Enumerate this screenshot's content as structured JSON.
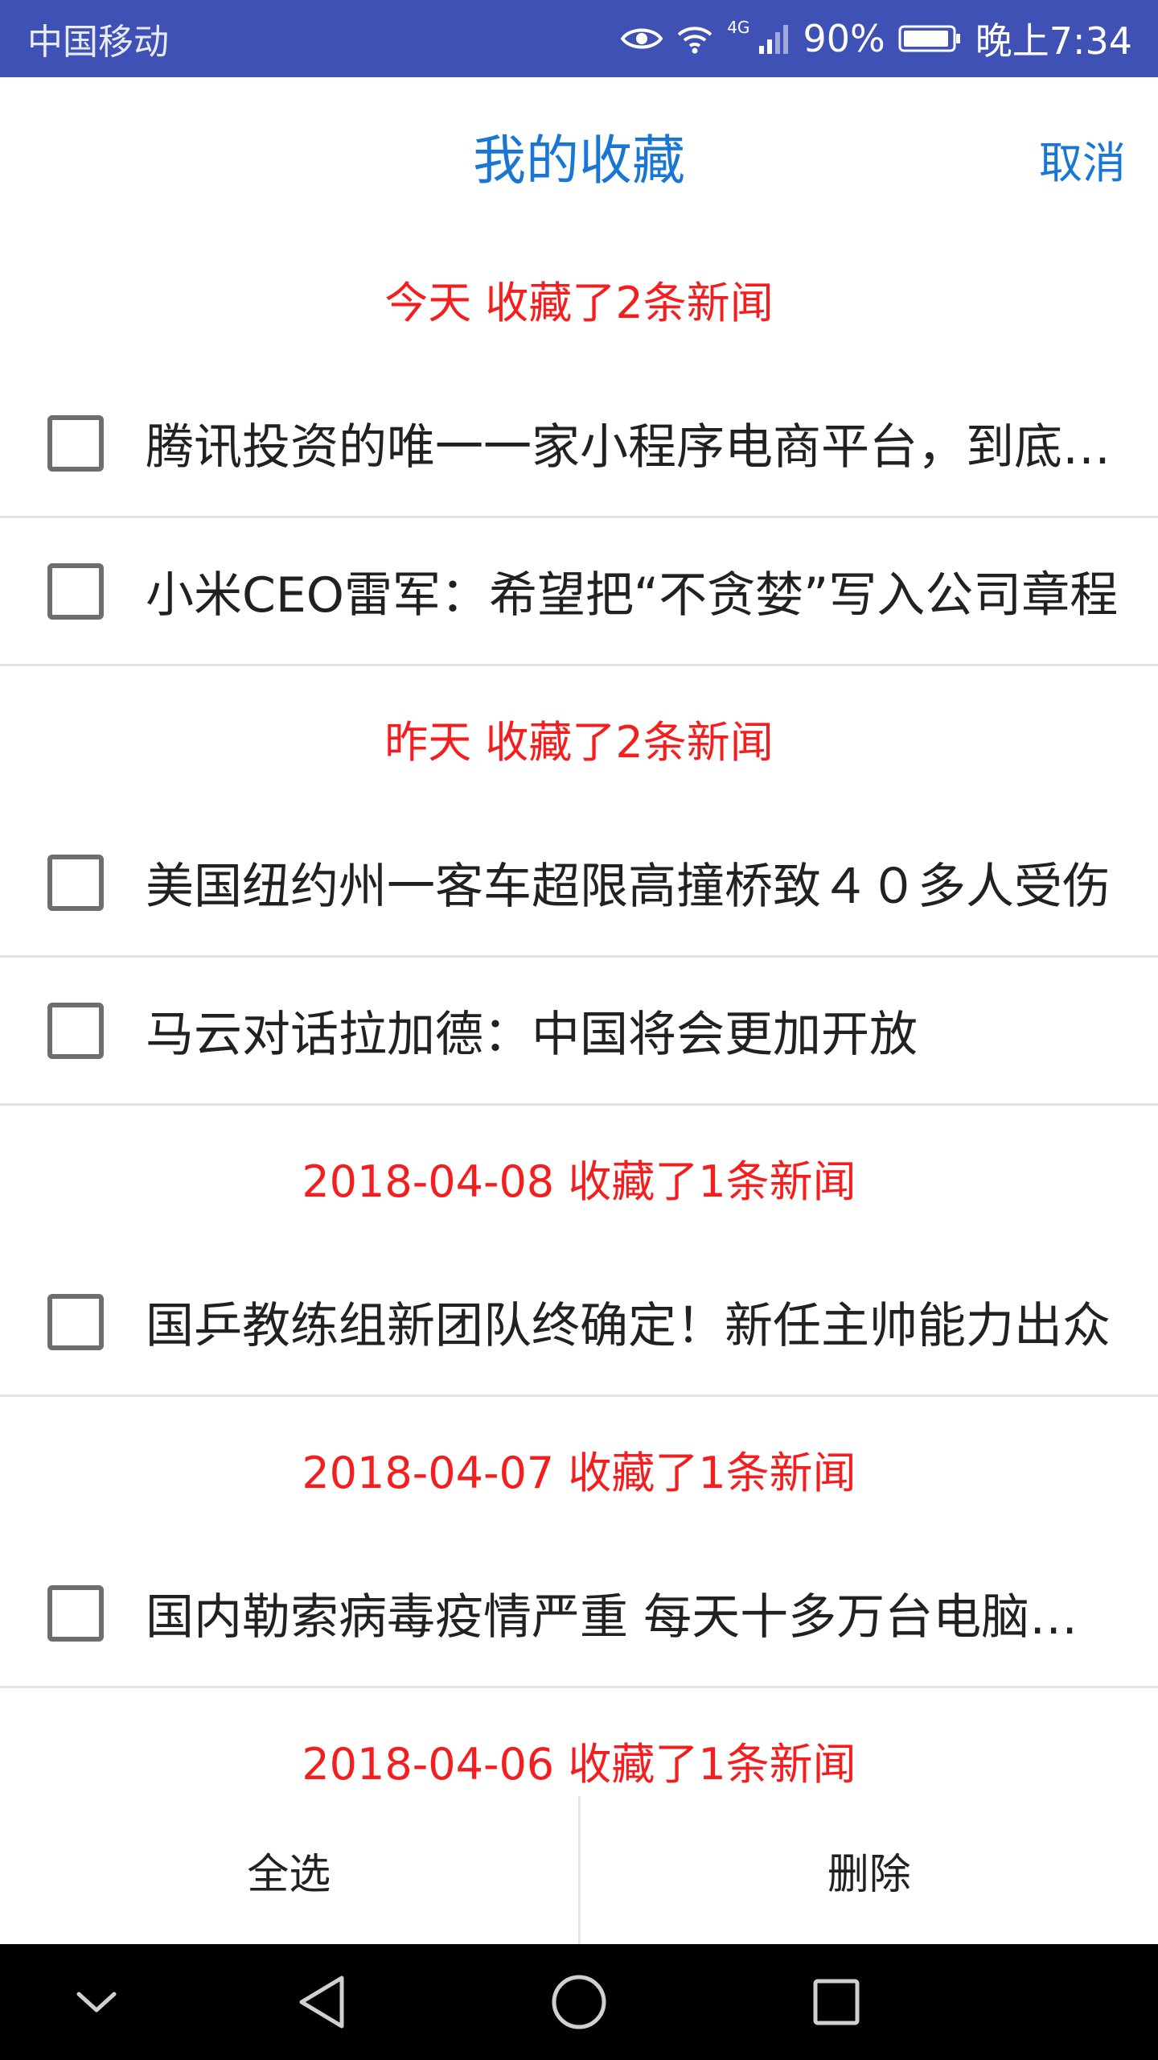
{
  "status_bar": {
    "carrier": "中国移动",
    "network_type": "4G",
    "battery": "90%",
    "time": "晚上7:34",
    "icons": [
      "eye-icon",
      "wifi-icon",
      "signal-icon",
      "battery-icon"
    ]
  },
  "header": {
    "title": "我的收藏",
    "cancel_label": "取消"
  },
  "groups": [
    {
      "label": "今天 收藏了2条新闻",
      "items": [
        {
          "title": "腾讯投资的唯一一家小程序电商平台，到底有何厉害之处"
        },
        {
          "title": "小米CEO雷军：希望把“不贪婪”写入公司章程"
        }
      ]
    },
    {
      "label": "昨天 收藏了2条新闻",
      "items": [
        {
          "title": "美国纽约州一客车超限高撞桥致４０多人受伤"
        },
        {
          "title": "马云对话拉加德：中国将会更加开放"
        }
      ]
    },
    {
      "label": "2018-04-08 收藏了1条新闻",
      "items": [
        {
          "title": "国乒教练组新团队终确定！新任主帅能力出众"
        }
      ]
    },
    {
      "label": "2018-04-07 收藏了1条新闻",
      "items": [
        {
          "title": "国内勒索病毒疫情严重 每天十多万台电脑中招"
        }
      ]
    },
    {
      "label": "2018-04-06 收藏了1条新闻",
      "items": []
    }
  ],
  "actions": {
    "select_all_label": "全选",
    "delete_label": "删除"
  },
  "colors": {
    "status_bar": "#3f51b5",
    "accent_blue": "#1976d2",
    "group_red": "#f41e1e"
  },
  "nav_bar": {
    "icons": [
      "chevron-down-icon",
      "back-icon",
      "home-icon",
      "recents-icon"
    ]
  }
}
